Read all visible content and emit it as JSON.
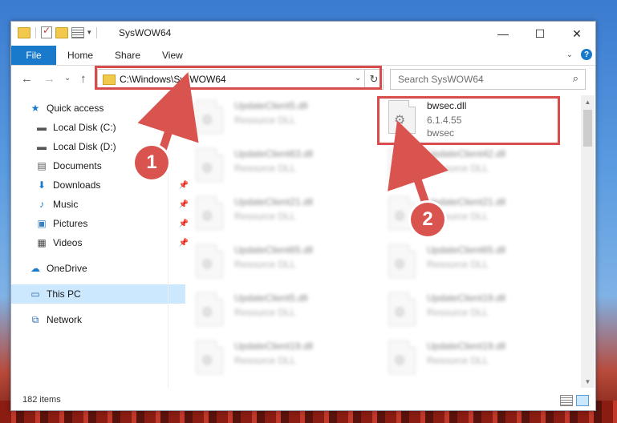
{
  "window": {
    "title": "SysWOW64"
  },
  "controls": {
    "minimize": "—",
    "maximize": "☐",
    "close": "✕"
  },
  "ribbon": {
    "file": "File",
    "home": "Home",
    "share": "Share",
    "view": "View",
    "help": "?"
  },
  "nav": {
    "back": "←",
    "forward": "→",
    "recent": "⌄",
    "up": "↑"
  },
  "address": {
    "path": "C:\\Windows\\SysWOW64",
    "dropdown": "⌄",
    "refresh": "↻"
  },
  "search": {
    "placeholder": "Search SysWOW64",
    "icon": "⌕"
  },
  "sidebar": {
    "items": [
      {
        "label": "Quick access",
        "icon": "star-icon",
        "glyph": "★"
      },
      {
        "label": "Local Disk (C:)",
        "icon": "drive-icon",
        "glyph": "▬"
      },
      {
        "label": "Local Disk (D:)",
        "icon": "drive-icon",
        "glyph": "▬"
      },
      {
        "label": "Documents",
        "icon": "document-icon",
        "glyph": "▤"
      },
      {
        "label": "Downloads",
        "icon": "download-icon",
        "glyph": "⬇"
      },
      {
        "label": "Music",
        "icon": "music-icon",
        "glyph": "♪"
      },
      {
        "label": "Pictures",
        "icon": "pictures-icon",
        "glyph": "▣"
      },
      {
        "label": "Videos",
        "icon": "video-icon",
        "glyph": "▦"
      },
      {
        "label": "OneDrive",
        "icon": "cloud-icon",
        "glyph": "☁"
      },
      {
        "label": "This PC",
        "icon": "computer-icon",
        "glyph": "▭"
      },
      {
        "label": "Network",
        "icon": "network-icon",
        "glyph": "⧉"
      }
    ],
    "pin": "📌"
  },
  "files": {
    "highlighted": {
      "name": "bwsec.dll",
      "version": "6.1.4.55",
      "desc": "bwsec"
    },
    "left": [
      {
        "name": "UpdateClient5.dll",
        "type": "Resource DLL"
      },
      {
        "name": "UpdateClient63.dll",
        "type": "Resource DLL"
      },
      {
        "name": "UpdateClient21.dll",
        "type": "Resource DLL"
      },
      {
        "name": "UpdateClient65.dll",
        "type": "Resource DLL"
      },
      {
        "name": "UpdateClient5.dll",
        "type": "Resource DLL"
      },
      {
        "name": "UpdateClient19.dll",
        "type": "Resource DLL"
      }
    ],
    "right": [
      {
        "name": "UpdateClient42.dll",
        "type": "Resource DLL"
      },
      {
        "name": "UpdateClient21.dll",
        "type": "Resource DLL"
      },
      {
        "name": "UpdateClient65.dll",
        "type": "Resource DLL"
      },
      {
        "name": "UpdateClient19.dll",
        "type": "Resource DLL"
      },
      {
        "name": "UpdateClient19.dll",
        "type": "Resource DLL"
      }
    ]
  },
  "status": {
    "count": "182 items"
  },
  "callouts": {
    "one": "1",
    "two": "2"
  },
  "colors": {
    "accent": "#1979ca",
    "callout": "#d9534f",
    "selection": "#cce8ff"
  }
}
